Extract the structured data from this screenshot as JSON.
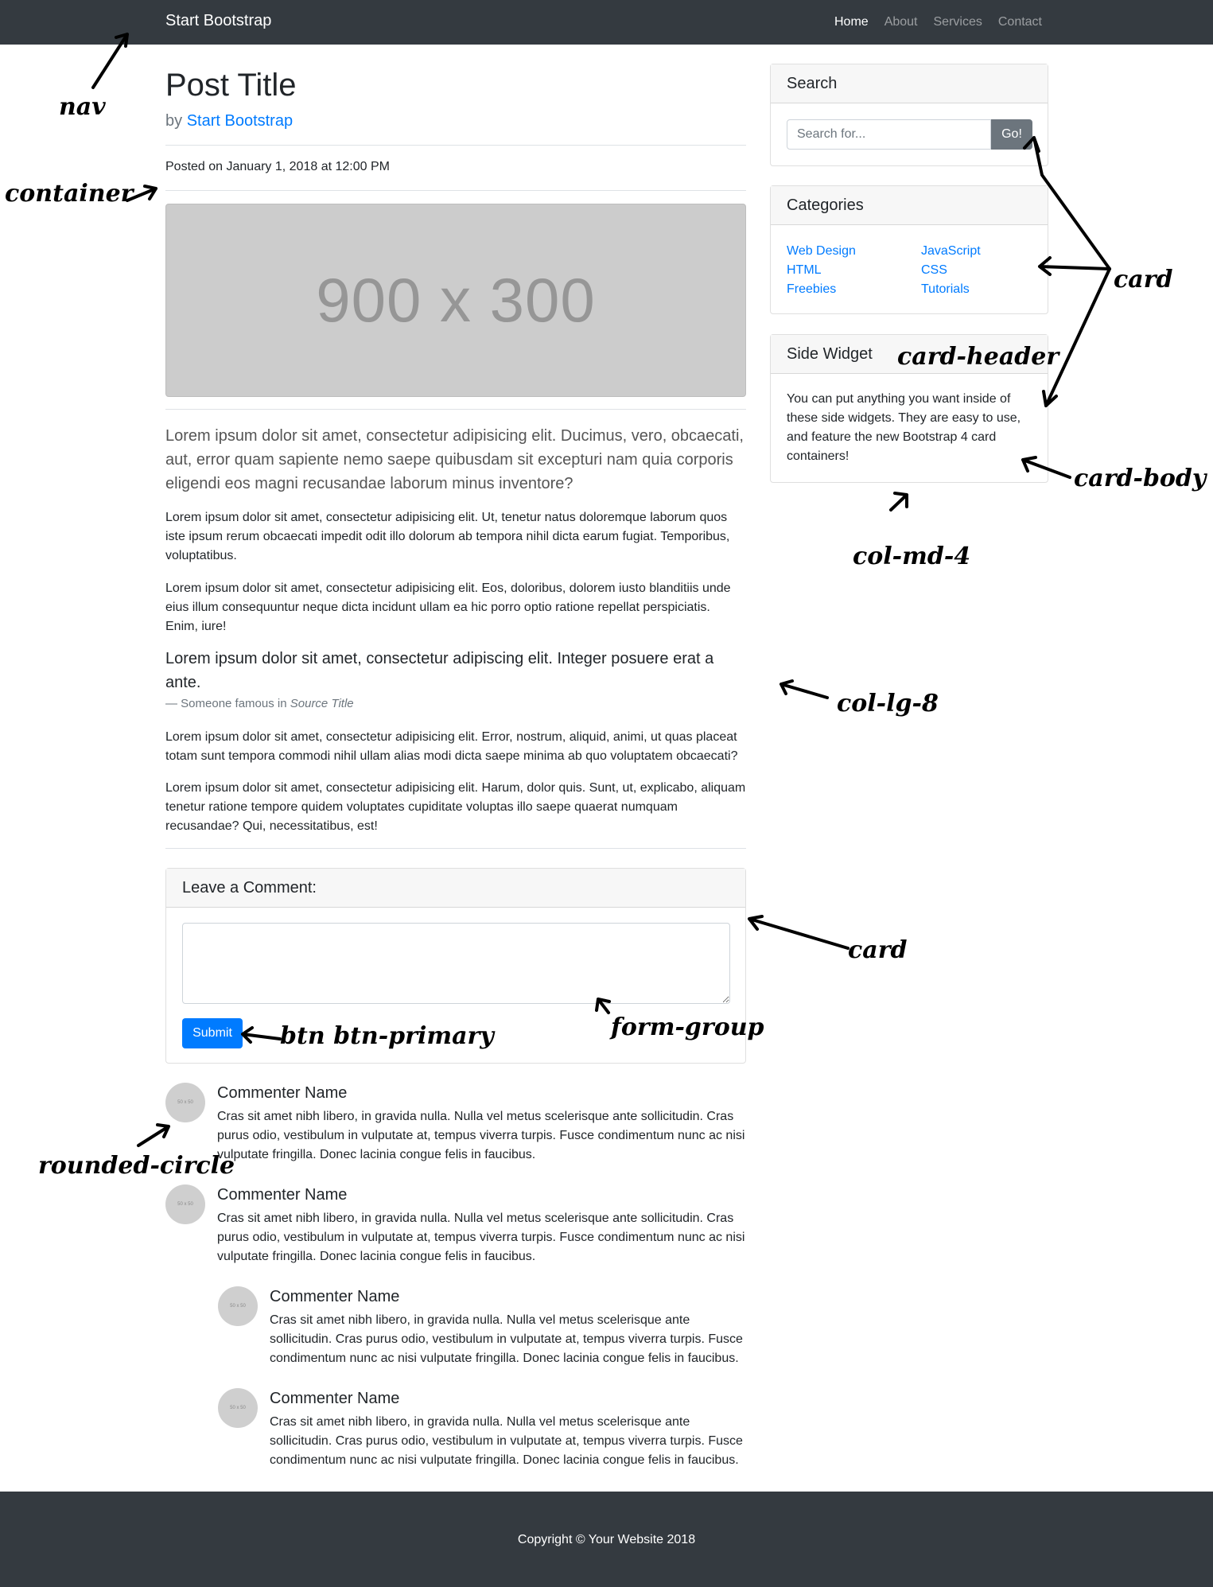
{
  "nav": {
    "brand": "Start Bootstrap",
    "links": [
      "Home",
      "About",
      "Services",
      "Contact"
    ],
    "active": "Home"
  },
  "post": {
    "title": "Post Title",
    "by": "by",
    "author": "Start Bootstrap",
    "posted": "Posted on January 1, 2018 at 12:00 PM",
    "image_label": "900 x 300",
    "lead": "Lorem ipsum dolor sit amet, consectetur adipisicing elit. Ducimus, vero, obcaecati, aut, error quam sapiente nemo saepe quibusdam sit excepturi nam quia corporis eligendi eos magni recusandae laborum minus inventore?",
    "paragraphs": [
      "Lorem ipsum dolor sit amet, consectetur adipisicing elit. Ut, tenetur natus doloremque laborum quos iste ipsum rerum obcaecati impedit odit illo dolorum ab tempora nihil dicta earum fugiat. Temporibus, voluptatibus.",
      "Lorem ipsum dolor sit amet, consectetur adipisicing elit. Eos, doloribus, dolorem iusto blanditiis unde eius illum consequuntur neque dicta incidunt ullam ea hic porro optio ratione repellat perspiciatis. Enim, iure!",
      "Lorem ipsum dolor sit amet, consectetur adipisicing elit. Error, nostrum, aliquid, animi, ut quas placeat totam sunt tempora commodi nihil ullam alias modi dicta saepe minima ab quo voluptatem obcaecati?",
      "Lorem ipsum dolor sit amet, consectetur adipisicing elit. Harum, dolor quis. Sunt, ut, explicabo, aliquam tenetur ratione tempore quidem voluptates cupiditate voluptas illo saepe quaerat numquam recusandae? Qui, necessitatibus, est!"
    ],
    "quote": "Lorem ipsum dolor sit amet, consectetur adipiscing elit. Integer posuere erat a ante.",
    "quote_footer_prefix": "— Someone famous in",
    "quote_source": "Source Title"
  },
  "comment_form": {
    "header": "Leave a Comment:",
    "textarea_value": "",
    "submit_label": "Submit"
  },
  "comments": [
    {
      "name": "Commenter Name",
      "text": "Cras sit amet nibh libero, in gravida nulla. Nulla vel metus scelerisque ante sollicitudin. Cras purus odio, vestibulum in vulputate at, tempus viverra turpis. Fusce condimentum nunc ac nisi vulputate fringilla. Donec lacinia congue felis in faucibus.",
      "avatar": "50 x 50"
    },
    {
      "name": "Commenter Name",
      "text": "Cras sit amet nibh libero, in gravida nulla. Nulla vel metus scelerisque ante sollicitudin. Cras purus odio, vestibulum in vulputate at, tempus viverra turpis. Fusce condimentum nunc ac nisi vulputate fringilla. Donec lacinia congue felis in faucibus.",
      "avatar": "50 x 50"
    },
    {
      "name": "Commenter Name",
      "text": "Cras sit amet nibh libero, in gravida nulla. Nulla vel metus scelerisque ante sollicitudin. Cras purus odio, vestibulum in vulputate at, tempus viverra turpis. Fusce condimentum nunc ac nisi vulputate fringilla. Donec lacinia congue felis in faucibus.",
      "avatar": "50 x 50"
    },
    {
      "name": "Commenter Name",
      "text": "Cras sit amet nibh libero, in gravida nulla. Nulla vel metus scelerisque ante sollicitudin. Cras purus odio, vestibulum in vulputate at, tempus viverra turpis. Fusce condimentum nunc ac nisi vulputate fringilla. Donec lacinia congue felis in faucibus.",
      "avatar": "50 x 50"
    }
  ],
  "sidebar": {
    "search": {
      "header": "Search",
      "placeholder": "Search for...",
      "value": "",
      "button": "Go!"
    },
    "categories": {
      "header": "Categories",
      "items": [
        "Web Design",
        "JavaScript",
        "HTML",
        "CSS",
        "Freebies",
        "Tutorials"
      ]
    },
    "widget": {
      "header": "Side Widget",
      "text": "You can put anything you want inside of these side widgets. They are easy to use, and feature the new Bootstrap 4 card containers!"
    }
  },
  "footer": {
    "copyright": "Copyright © Your Website 2018"
  },
  "annotations": {
    "nav": "nav",
    "container": "container",
    "card_top": "card",
    "card_header": "card-header",
    "card_body": "card-body",
    "col_md_4": "col-md-4",
    "col_lg_8": "col-lg-8",
    "card_bottom": "card",
    "form_group": "form-group",
    "btn_primary": "btn btn-primary",
    "rounded_circle": "rounded-circle"
  },
  "colors": {
    "navbar": "#343a40",
    "primary": "#007bff",
    "secondary": "#6c757d",
    "placeholder": "#cccccc"
  }
}
